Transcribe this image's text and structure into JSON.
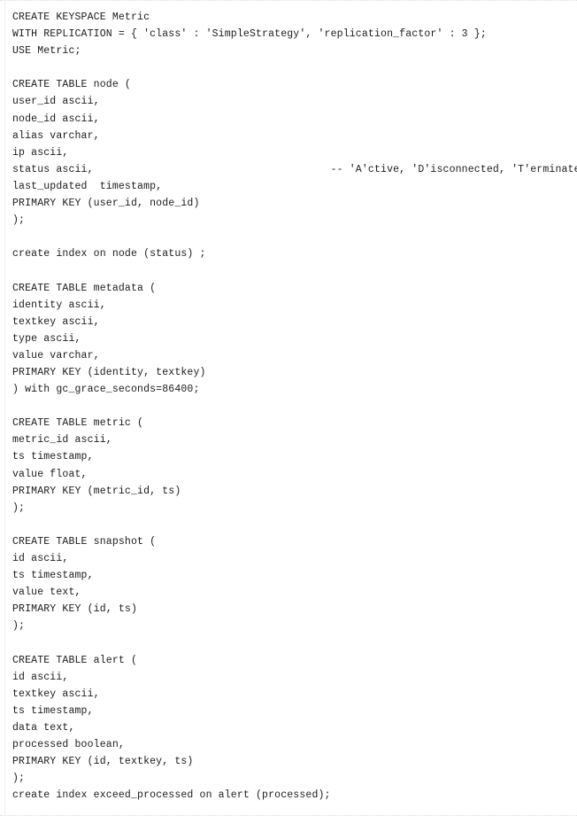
{
  "document": {
    "kind": "code-listing",
    "language": "cql",
    "background_color": "#ffffff",
    "text_color": "#1c1c1c",
    "border_color": "#e2e2e6",
    "lines": [
      "CREATE KEYSPACE Metric",
      "WITH REPLICATION = { 'class' : 'SimpleStrategy', 'replication_factor' : 3 };",
      "USE Metric;",
      "",
      "CREATE TABLE node (",
      "user_id ascii,",
      "node_id ascii,",
      "alias varchar,",
      "ip ascii,",
      "status ascii,                                      -- 'A'ctive, 'D'isconnected, 'T'erminated",
      "last_updated  timestamp,",
      "PRIMARY KEY (user_id, node_id)",
      ");",
      "",
      "create index on node (status) ;",
      "",
      "CREATE TABLE metadata (",
      "identity ascii,",
      "textkey ascii,",
      "type ascii,",
      "value varchar,",
      "PRIMARY KEY (identity, textkey)",
      ") with gc_grace_seconds=86400;",
      "",
      "CREATE TABLE metric (",
      "metric_id ascii,",
      "ts timestamp,",
      "value float,",
      "PRIMARY KEY (metric_id, ts)",
      ");",
      "",
      "CREATE TABLE snapshot (",
      "id ascii,",
      "ts timestamp,",
      "value text,",
      "PRIMARY KEY (id, ts)",
      ");",
      "",
      "CREATE TABLE alert (",
      "id ascii,",
      "textkey ascii,",
      "ts timestamp,",
      "data text,",
      "processed boolean,",
      "PRIMARY KEY (id, textkey, ts)",
      ");",
      "create index exceed_processed on alert (processed);"
    ]
  }
}
